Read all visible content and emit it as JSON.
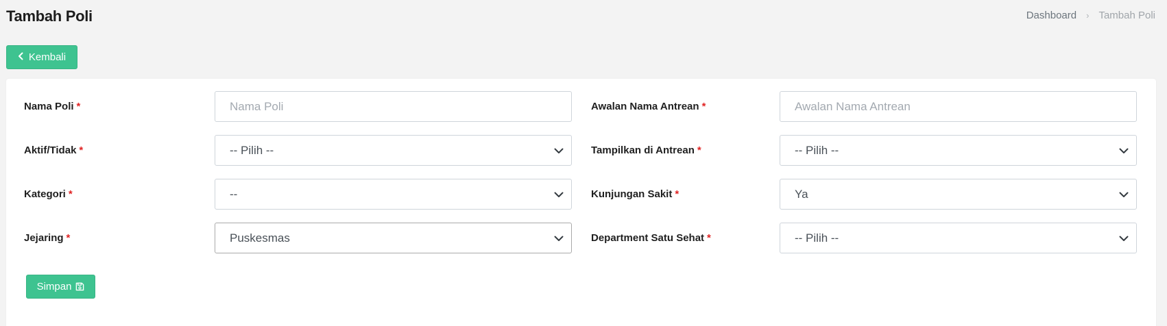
{
  "header": {
    "title": "Tambah Poli",
    "breadcrumb": [
      {
        "label": "Dashboard"
      },
      {
        "label": "Tambah Poli"
      }
    ],
    "breadcrumb_separator": "›"
  },
  "back_button": {
    "label": "Kembali",
    "icon": "chevron-left-icon"
  },
  "form": {
    "required_mark": "*",
    "fields": {
      "nama_poli": {
        "label": "Nama Poli",
        "placeholder": "Nama Poli",
        "value": ""
      },
      "awalan_nama_antrean": {
        "label": "Awalan Nama Antrean",
        "placeholder": "Awalan Nama Antrean",
        "value": ""
      },
      "aktif_tidak": {
        "label": "Aktif/Tidak",
        "selected": "-- Pilih --"
      },
      "tampilkan_di_antrean": {
        "label": "Tampilkan di Antrean",
        "selected": "-- Pilih --"
      },
      "kategori": {
        "label": "Kategori",
        "selected": "--"
      },
      "kunjungan_sakit": {
        "label": "Kunjungan Sakit",
        "selected": "Ya"
      },
      "jejaring": {
        "label": "Jejaring",
        "selected": "Puskesmas"
      },
      "department_satu_sehat": {
        "label": "Department Satu Sehat",
        "selected": "-- Pilih --"
      }
    },
    "save_button": {
      "label": "Simpan",
      "icon": "floppy-disk-icon"
    }
  },
  "colors": {
    "primary": "#3ec390",
    "required": "#e02424",
    "background": "#f3f3f3"
  }
}
